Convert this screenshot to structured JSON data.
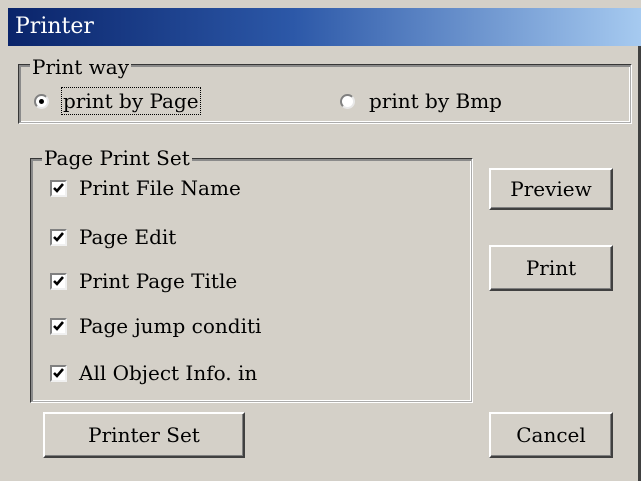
{
  "window": {
    "title": "Printer"
  },
  "print_way": {
    "legend": "Print way",
    "options": [
      {
        "label": "print by Page",
        "selected": true
      },
      {
        "label": "print by Bmp",
        "selected": false
      }
    ]
  },
  "page_print_set": {
    "legend": "Page Print Set",
    "items": [
      {
        "label": "Print File Name",
        "checked": true
      },
      {
        "label": "Page Edit",
        "checked": true
      },
      {
        "label": "Print Page Title",
        "checked": true
      },
      {
        "label": "Page jump conditi",
        "checked": true
      },
      {
        "label": "All Object Info. in",
        "checked": true
      }
    ]
  },
  "buttons": {
    "preview": "Preview",
    "print": "Print",
    "printer_set": "Printer Set",
    "cancel": "Cancel"
  }
}
